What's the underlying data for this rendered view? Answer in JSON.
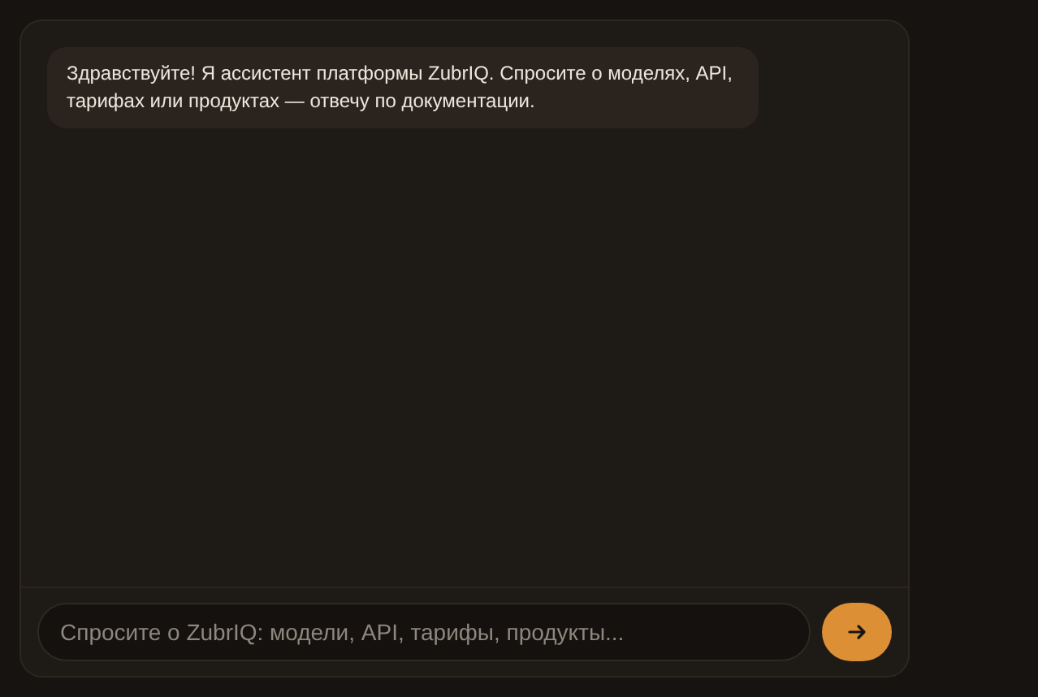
{
  "messages": [
    {
      "kind": "assistant",
      "text": "Здравствуйте! Я ассистент платформы ZubrIQ. Спросите о моделях, API, тарифах или продуктах — отвечу по документации."
    }
  ],
  "composer": {
    "placeholder": "Спросите о ZubrIQ: модели, API, тарифы, продукты..."
  }
}
